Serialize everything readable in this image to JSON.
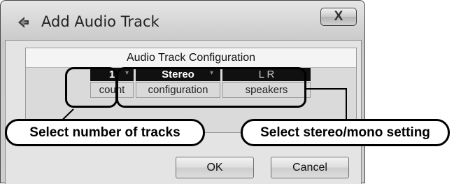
{
  "window": {
    "title": "Add Audio Track",
    "close_label": "X"
  },
  "config": {
    "header": "Audio Track Configuration",
    "count_value": "1",
    "count_label": "count",
    "configuration_value": "Stereo",
    "configuration_label": "configuration",
    "speakers_value": "L R",
    "speakers_label": "speakers"
  },
  "callouts": {
    "left": "Select number of tracks",
    "right": "Select stereo/mono setting"
  },
  "buttons": {
    "ok": "OK",
    "cancel": "Cancel"
  },
  "icons": {
    "app_icon": "cubase-arrow-icon",
    "dropdown_arrow": "chevron-down-icon"
  }
}
